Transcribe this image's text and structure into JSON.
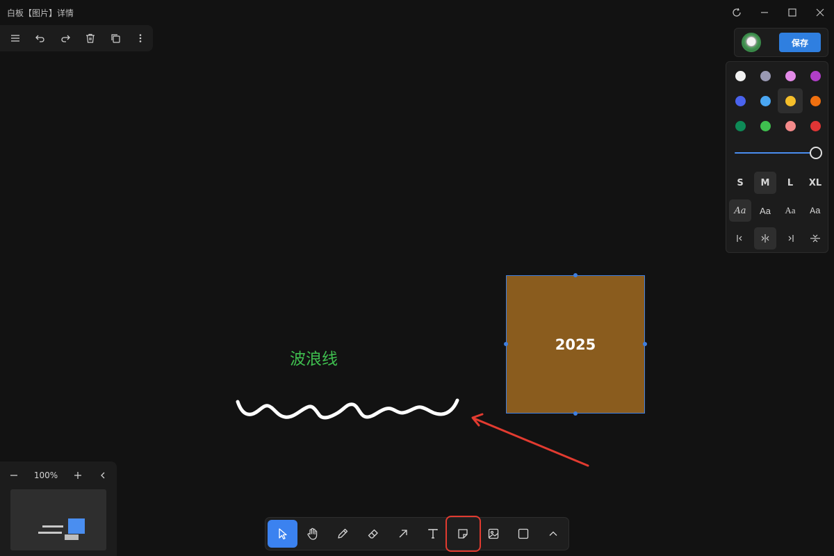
{
  "window": {
    "title": "白板【图片】详情",
    "controls": [
      "refresh-icon",
      "minimize-icon",
      "maximize-icon",
      "close-icon"
    ]
  },
  "top_toolbar": {
    "items": [
      "menu-icon",
      "undo-icon",
      "redo-icon",
      "trash-icon",
      "duplicate-icon",
      "more-icon"
    ]
  },
  "header_panel": {
    "avatar": "user-avatar",
    "save_label": "保存",
    "accent": "#2f7fe0"
  },
  "style_panel": {
    "colors": [
      "#f2f2f2",
      "#9999b3",
      "#e38be8",
      "#b03ec8",
      "#4a63ee",
      "#4aa6f2",
      "#f6bf2a",
      "#f0700f",
      "#0e8a57",
      "#3fbf4f",
      "#f48a8a",
      "#e03535"
    ],
    "selected_color_index": 6,
    "opacity_percent": 100,
    "sizes": [
      "S",
      "M",
      "L",
      "XL"
    ],
    "selected_size": "M",
    "fonts": [
      "Aa",
      "Aa",
      "Aa",
      "Aa"
    ],
    "selected_font_index": 0,
    "alignment_icons": [
      "align-left-icon",
      "align-center-icon",
      "align-right-icon",
      "distribute-vertical-icon"
    ],
    "selected_alignment_index": 1
  },
  "canvas": {
    "wave_label": "波浪线",
    "wave_label_color": "#3fbf4f",
    "sticky_note": {
      "text": "2025",
      "color": "#8a5c1e",
      "selected": true
    },
    "arrow_color": "#e23b30"
  },
  "zoom": {
    "value": "100%"
  },
  "bottom_toolbar": {
    "tools": [
      "select-icon",
      "hand-icon",
      "pencil-icon",
      "eraser-icon",
      "arrow-icon",
      "text-icon",
      "sticky-note-icon",
      "image-icon",
      "rectangle-icon",
      "chevron-up-icon"
    ],
    "active_tool": "select-icon",
    "highlighted_tool": "sticky-note-icon",
    "highlight_color": "#e23b30"
  }
}
